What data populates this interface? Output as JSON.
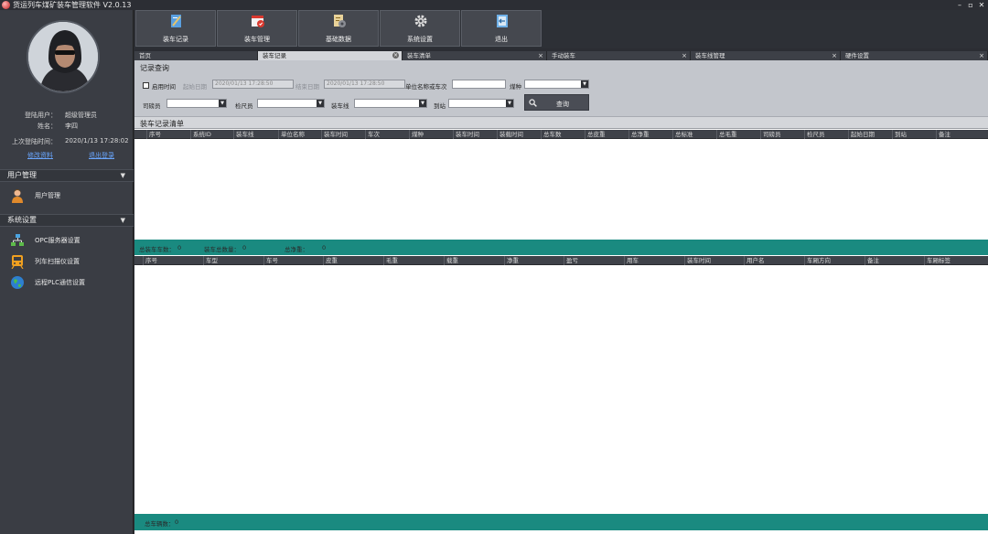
{
  "window": {
    "title": "货运列车煤矿装车管理软件 V2.0.13",
    "controls": [
      "–",
      "▫",
      "✕"
    ]
  },
  "sidebar": {
    "user": {
      "login_label": "登陆用户：",
      "login_value": "超级管理员",
      "name_label": "姓名：",
      "name_value": "李四",
      "last_login_label": "上次登陆时间：",
      "last_login_value": "2020/1/13 17:28:02",
      "edit_link": "修改资料",
      "logout_link": "退出登录"
    },
    "sections": [
      {
        "title": "用户管理",
        "arrow": "▼",
        "items": [
          {
            "label": "用户管理",
            "icon": "user-icon"
          }
        ]
      },
      {
        "title": "系统设置",
        "arrow": "▼",
        "items": [
          {
            "label": "OPC服务器设置",
            "icon": "network-icon"
          },
          {
            "label": "列车扫描仪设置",
            "icon": "train-icon"
          },
          {
            "label": "远程PLC通信设置",
            "icon": "globe-icon"
          }
        ]
      }
    ]
  },
  "toolbar": {
    "buttons": [
      {
        "label": "装车记录",
        "icon": "record-icon"
      },
      {
        "label": "装车管理",
        "icon": "calendar-icon"
      },
      {
        "label": "基础数据",
        "icon": "data-icon"
      },
      {
        "label": "系统设置",
        "icon": "gear-icon"
      },
      {
        "label": "退出",
        "icon": "exit-icon"
      }
    ]
  },
  "doc_tabs": [
    {
      "label": "首页",
      "closable": false,
      "active": false
    },
    {
      "label": "装车记录",
      "closable": true,
      "active": true
    },
    {
      "label": "装车清单",
      "closable": true,
      "active": false
    },
    {
      "label": "手动装车",
      "closable": true,
      "active": false
    },
    {
      "label": "装车线管理",
      "closable": true,
      "active": false
    },
    {
      "label": "硬件设置",
      "closable": true,
      "active": false
    }
  ],
  "query": {
    "section_title": "记录查询",
    "enable_time_label": "启用时间",
    "start_date_label": "起始日期",
    "start_date_value": "2020/01/13 17:28:50",
    "end_date_label": "结束日期",
    "end_date_value": "2020/01/13 17:28:50",
    "unit_label": "单位名称或车次",
    "unit_value": "",
    "coal_label": "煤种",
    "operator_label": "司磅员",
    "inspector_label": "检尺员",
    "line_label": "装车线",
    "station_label": "到站",
    "search_label": "查询"
  },
  "records": {
    "section_title": "装车记录清单",
    "columns": [
      "序号",
      "系统ID",
      "装车线",
      "单位名称",
      "装车时间",
      "车次",
      "煤种",
      "装车时间",
      "装载时间",
      "总车数",
      "总皮重",
      "总净重",
      "总标准",
      "总毛重",
      "司磅员",
      "检尺员",
      "起始日期",
      "到站",
      "备注"
    ],
    "rows": []
  },
  "summary1": {
    "total_cars_label": "总装车车数：",
    "total_cars_value": "0",
    "total_weight_label": "装车总数量：",
    "total_weight_value": "0",
    "total_net_label": "总净重：",
    "total_net_value": "0"
  },
  "details": {
    "columns": [
      "序号",
      "车型",
      "车号",
      "皮重",
      "毛重",
      "载重",
      "净重",
      "盈亏",
      "用车",
      "装车时间",
      "用户名",
      "车厢方向",
      "备注",
      "车厢标签"
    ],
    "rows": []
  },
  "summary2": {
    "total_label": "总车辆数：",
    "total_value": "0"
  },
  "colors": {
    "accent_teal": "#1a8a80",
    "dark_bg": "#2b2d33",
    "link": "#6aa7ff"
  }
}
